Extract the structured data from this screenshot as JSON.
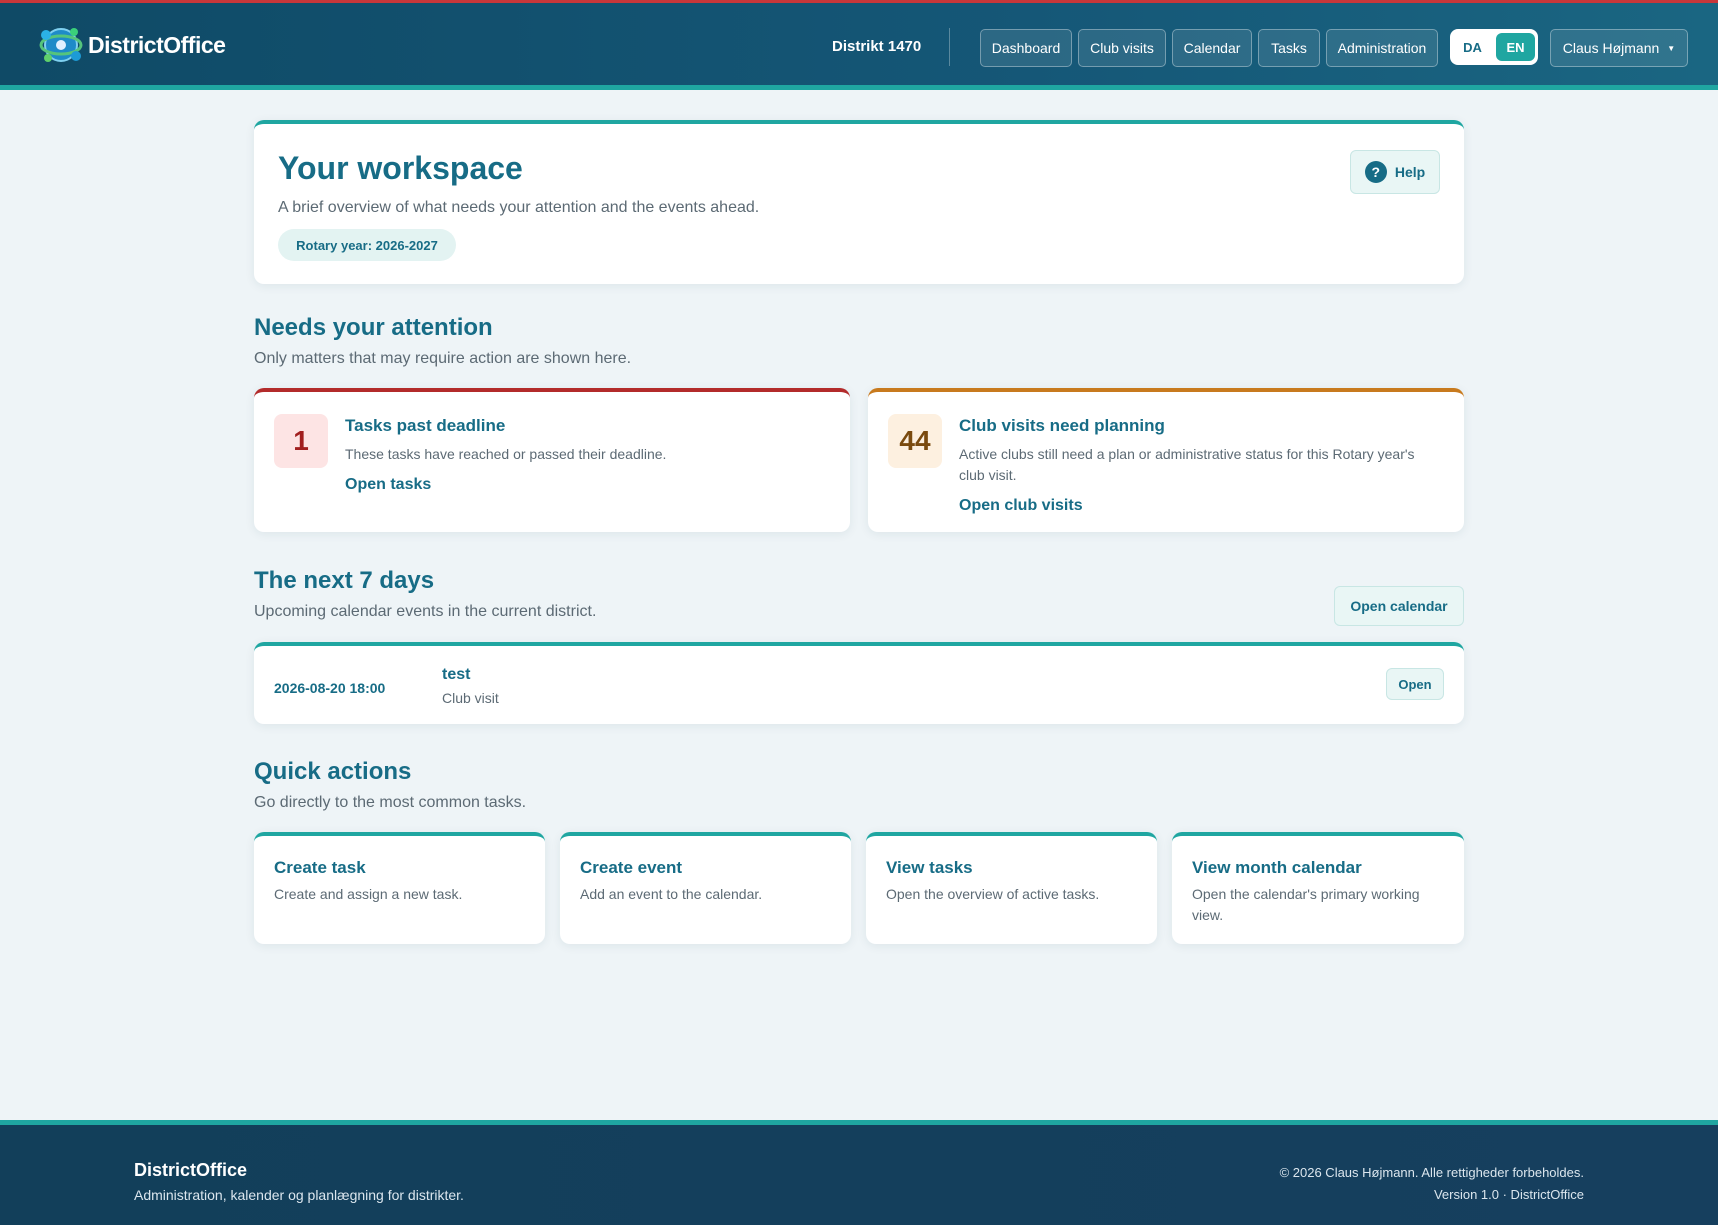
{
  "header": {
    "brand": "DistrictOffice",
    "district": "Distrikt 1470",
    "nav": [
      "Dashboard",
      "Club visits",
      "Calendar",
      "Tasks",
      "Administration"
    ],
    "lang": [
      "DA",
      "EN"
    ],
    "active_lang": "EN",
    "user": "Claus Højmann"
  },
  "workspace": {
    "title": "Your workspace",
    "subtitle": "A brief overview of what needs your attention and the events ahead.",
    "rotary_year": "Rotary year: 2026-2027",
    "help": "Help"
  },
  "attention": {
    "title": "Needs your attention",
    "subtitle": "Only matters that may require action are shown here.",
    "cards": [
      {
        "count": "1",
        "title": "Tasks past deadline",
        "desc": "These tasks have reached or passed their deadline.",
        "link": "Open tasks",
        "accent": "#b32b2b"
      },
      {
        "count": "44",
        "title": "Club visits need planning",
        "desc": "Active clubs still need a plan or administrative status for this Rotary year's club visit.",
        "link": "Open club visits",
        "accent": "#c87a1e"
      }
    ]
  },
  "next7": {
    "title": "The next 7 days",
    "subtitle": "Upcoming calendar events in the current district.",
    "open_calendar": "Open calendar",
    "event": {
      "datetime": "2026-08-20 18:00",
      "name": "test",
      "type": "Club visit",
      "open": "Open"
    }
  },
  "quick": {
    "title": "Quick actions",
    "subtitle": "Go directly to the most common tasks.",
    "items": [
      {
        "title": "Create task",
        "desc": "Create and assign a new task."
      },
      {
        "title": "Create event",
        "desc": "Add an event to the calendar."
      },
      {
        "title": "View tasks",
        "desc": "Open the overview of active tasks."
      },
      {
        "title": "View month calendar",
        "desc": "Open the calendar's primary working view."
      }
    ]
  },
  "footer": {
    "brand": "DistrictOffice",
    "tagline": "Administration, kalender og planlægning for distrikter.",
    "copyright": "© 2026 Claus Højmann. Alle rettigheder forbeholdes.",
    "version": "Version 1.0 · DistrictOffice"
  }
}
